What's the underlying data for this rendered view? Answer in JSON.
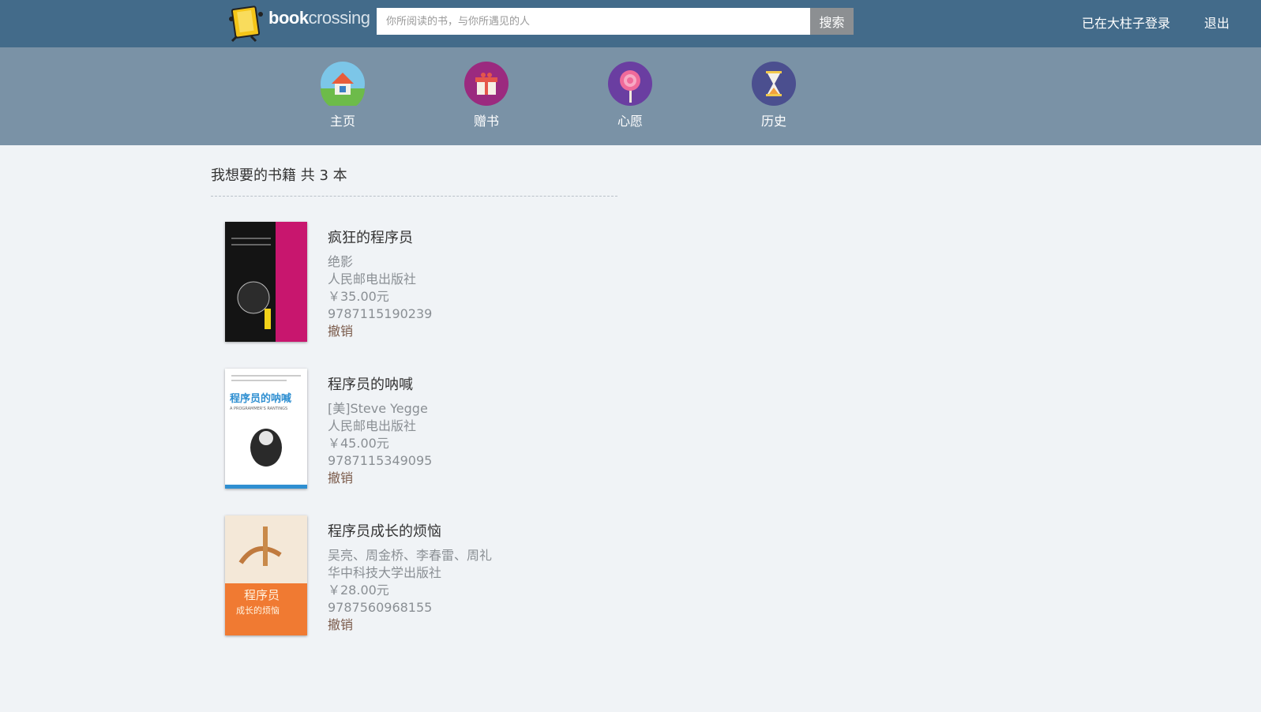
{
  "brand": {
    "logo_part1": "book",
    "logo_part2": "crossing"
  },
  "search": {
    "placeholder": "你所阅读的书，与你所遇见的人",
    "button_label": "搜索"
  },
  "header_links": {
    "login": "已在大柱子登录",
    "logout": "退出"
  },
  "subnav": [
    {
      "label": "主页",
      "icon": "home-icon"
    },
    {
      "label": "赠书",
      "icon": "gift-icon"
    },
    {
      "label": "心愿",
      "icon": "lollipop-icon"
    },
    {
      "label": "历史",
      "icon": "hourglass-icon"
    }
  ],
  "page_heading": "我想要的书籍 共 3 本",
  "books": [
    {
      "title": "疯狂的程序员",
      "author": "绝影",
      "publisher": "人民邮电出版社",
      "price": "￥35.00元",
      "isbn": "9787115190239",
      "action": "撤销"
    },
    {
      "title": "程序员的呐喊",
      "author": "[美]Steve Yegge",
      "publisher": "人民邮电出版社",
      "price": "￥45.00元",
      "isbn": "9787115349095",
      "action": "撤销"
    },
    {
      "title": "程序员成长的烦恼",
      "author": "吴亮、周金桥、李春雷、周礼",
      "publisher": "华中科技大学出版社",
      "price": "￥28.00元",
      "isbn": "9787560968155",
      "action": "撤销"
    }
  ],
  "covers": [
    {
      "text": "疯狂的程序员"
    },
    {
      "text": "程序员的呐喊",
      "subtext": "A PROGRAMMER'S RANTINGS"
    },
    {
      "text": "程序员",
      "subtext": "成长的烦恼"
    }
  ],
  "colors": {
    "topbar": "#436b8a",
    "subnav": "#7a92a6",
    "background": "#f0f3f6"
  }
}
